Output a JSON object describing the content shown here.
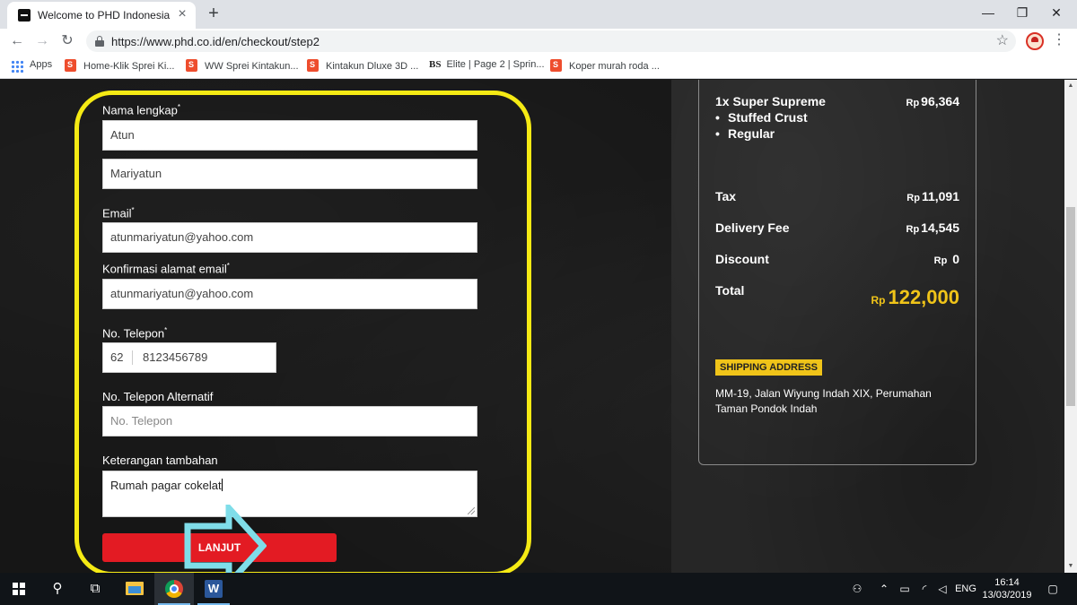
{
  "browser": {
    "tab_title": "Welcome to PHD Indonesia",
    "tab_close": "×",
    "new_tab": "+",
    "url": "https://www.phd.co.id/en/checkout/step2",
    "window_controls": {
      "minimize": "—",
      "maximize": "❐",
      "close": "✕"
    },
    "nav": {
      "back": "←",
      "forward": "→",
      "reload": "↻"
    },
    "bookmarks": [
      {
        "label": "Apps"
      },
      {
        "label": "Home-Klik Sprei Ki..."
      },
      {
        "label": "WW Sprei Kintakun..."
      },
      {
        "label": "Kintakun Dluxe 3D ..."
      },
      {
        "label": "Elite | Page 2 | Sprin..."
      },
      {
        "label": "Koper murah roda ..."
      }
    ],
    "bs_mark": "BS"
  },
  "form": {
    "full_name_label": "Nama lengkap",
    "required_mark": "*",
    "first_name_value": "Atun",
    "last_name_value": "Mariyatun",
    "email_label": "Email",
    "email_value": "atunmariyatun@yahoo.com",
    "confirm_email_label": "Konfirmasi alamat email",
    "confirm_email_value": "atunmariyatun@yahoo.com",
    "phone_label": "No. Telepon",
    "phone_prefix": "62",
    "phone_value": "8123456789",
    "alt_phone_label": "No. Telepon Alternatif",
    "alt_phone_placeholder": "No. Telepon",
    "notes_label": "Keterangan tambahan",
    "notes_value": "Rumah pagar cokelat",
    "submit_label": "LANJUT"
  },
  "summary": {
    "item_line": "1x Super Supreme",
    "item_options": [
      "Stuffed Crust",
      "Regular"
    ],
    "bullet": "•",
    "currency": "Rp",
    "item_price": "96,364",
    "tax_label": "Tax",
    "tax_value": "11,091",
    "delivery_label": "Delivery Fee",
    "delivery_value": "14,545",
    "discount_label": "Discount",
    "discount_value": "0",
    "total_label": "Total",
    "total_value": "122,000",
    "shipping_badge": "SHIPPING ADDRESS",
    "shipping_address": "MM-19, Jalan Wiyung Indah XIX, Perumahan Taman Pondok Indah"
  },
  "annotation": {
    "highlight_color": "#f5ea14",
    "arrow_color": "#7fdde9"
  },
  "colors": {
    "submit_button": "#e31b23",
    "total_accent": "#f0c419"
  },
  "taskbar": {
    "word_letter": "W",
    "language": "ENG",
    "time": "16:14",
    "date": "13/03/2019"
  }
}
